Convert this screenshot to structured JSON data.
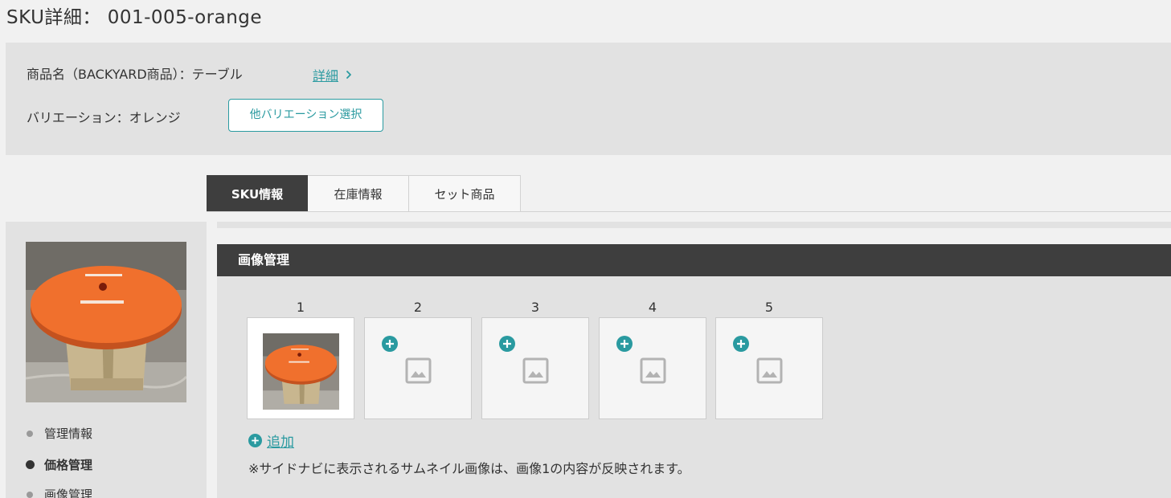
{
  "page": {
    "title": "SKU詳細： 001-005-orange"
  },
  "product": {
    "name_label": "商品名（BACKYARD商品）：テーブル",
    "detail_link": "詳細",
    "variation_label": "バリエーション：オレンジ",
    "variation_button": "他バリエーション選択"
  },
  "tabs": [
    {
      "label": "SKU情報",
      "active": true
    },
    {
      "label": "在庫情報",
      "active": false
    },
    {
      "label": "セット商品",
      "active": false
    }
  ],
  "sidebar": {
    "nav": [
      {
        "label": "管理情報",
        "active": false
      },
      {
        "label": "価格管理",
        "active": true
      },
      {
        "label": "画像管理",
        "active": false
      }
    ]
  },
  "image_section": {
    "title": "画像管理",
    "slots": [
      {
        "number": "1",
        "filled": true
      },
      {
        "number": "2",
        "filled": false
      },
      {
        "number": "3",
        "filled": false
      },
      {
        "number": "4",
        "filled": false
      },
      {
        "number": "5",
        "filled": false
      }
    ],
    "add_label": "追加",
    "note": "※サイドナビに表示されるサムネイル画像は、画像1の内容が反映されます。"
  },
  "colors": {
    "accent": "#2a9aa0",
    "dark_header": "#3e3e3e",
    "panel_bg": "#e2e2e2",
    "page_bg": "#f1f1f1",
    "table_orange": "#f0702d"
  },
  "icons": {
    "detail_chevron": "chevron-right-icon",
    "slot_add": "plus-circle-icon",
    "slot_placeholder": "image-placeholder-icon",
    "add_link": "plus-circle-icon"
  }
}
